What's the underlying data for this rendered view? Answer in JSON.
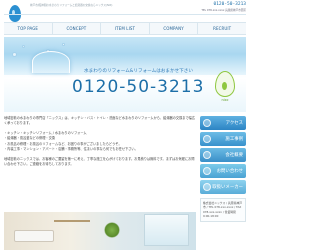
{
  "header": {
    "tagline": "神戸市/阪神間の水まわりリフォームと給湯器の交換ならニックス(NIX)",
    "logo_text": "nixc",
    "phone": "0120-50-3213",
    "address": "TEL 078-xxx-xxxx 兵庫県神戸市西区"
  },
  "nav": {
    "items": [
      {
        "label": "TOP PAGE"
      },
      {
        "label": "CONCEPT"
      },
      {
        "label": "ITEM LIST"
      },
      {
        "label": "COMPANY"
      },
      {
        "label": "RECRUIT"
      }
    ]
  },
  "hero": {
    "message": "水まわりのリフォーム&リフォームはおまかせ下さい",
    "phone": "0120-50-3213",
    "logo_text": "nixc"
  },
  "content": {
    "intro": "地域密着の水まわりの専門店「ニックス」は、キッチン・バス・トイレ・洗面など水まわりのリフォームから、給湯器の交換まで幅広く承っております。",
    "bullets": [
      "・キッチン・キッチンリフォーム / 水まわりのリフォーム",
      "・給湯器・風呂釜などの修理・交換",
      "・お風呂の修理・お風呂のリフォームなど、お困りの事がございましたらどうぞ。",
      "・内装工事・マンション・アパート・店舗・事務所等、住まいの事なら何でもお任せ下さい。"
    ],
    "paragraph": "地域密着のニックスでは、お客様のご要望を第一に考え、丁寧な施工を心がけております。お見積りは無料です。まずはお気軽にお問い合わせ下さい。ご連絡をお待ちしております。"
  },
  "sidebar": {
    "buttons": [
      {
        "label": "アクセス"
      },
      {
        "label": "施工事例"
      },
      {
        "label": "会社概要"
      },
      {
        "label": "お問い合わせ"
      },
      {
        "label": "取扱いメーカー"
      }
    ],
    "info": "株式会社ニックス / 兵庫県神戸市 / TEL 078-xxx-xxxx / FAX 078-xxx-xxxx / 営業時間 9:00-18:00"
  }
}
